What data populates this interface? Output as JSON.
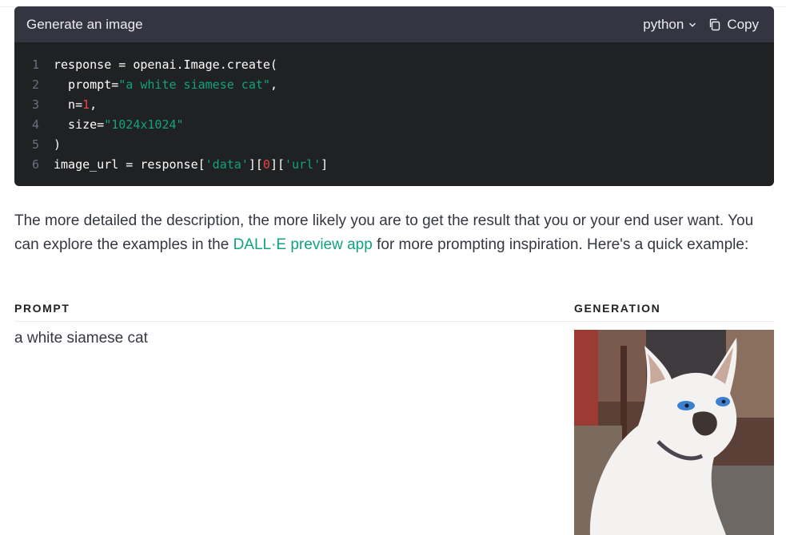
{
  "code_block": {
    "title": "Generate an image",
    "language": "python",
    "copy_label": "Copy",
    "lines": [
      {
        "n": "1",
        "parts": [
          {
            "t": "response = openai.Image.create(",
            "k": "plain"
          }
        ]
      },
      {
        "n": "2",
        "parts": [
          {
            "t": "  prompt=",
            "k": "plain"
          },
          {
            "t": "\"a white siamese cat\"",
            "k": "str"
          },
          {
            "t": ",",
            "k": "plain"
          }
        ]
      },
      {
        "n": "3",
        "parts": [
          {
            "t": "  n=",
            "k": "plain"
          },
          {
            "t": "1",
            "k": "num"
          },
          {
            "t": ",",
            "k": "plain"
          }
        ]
      },
      {
        "n": "4",
        "parts": [
          {
            "t": "  size=",
            "k": "plain"
          },
          {
            "t": "\"1024x1024\"",
            "k": "str"
          }
        ]
      },
      {
        "n": "5",
        "parts": [
          {
            "t": ")",
            "k": "plain"
          }
        ]
      },
      {
        "n": "6",
        "parts": [
          {
            "t": "image_url = response[",
            "k": "plain"
          },
          {
            "t": "'data'",
            "k": "str"
          },
          {
            "t": "][",
            "k": "plain"
          },
          {
            "t": "0",
            "k": "num"
          },
          {
            "t": "][",
            "k": "plain"
          },
          {
            "t": "'url'",
            "k": "str"
          },
          {
            "t": "]",
            "k": "plain"
          }
        ]
      }
    ]
  },
  "description": {
    "before_link": "The more detailed the description, the more likely you are to get the result that you or your end user want. You can explore the examples in the ",
    "link_text": "DALL·E preview app",
    "after_link": " for more prompting inspiration. Here's a quick example:"
  },
  "example_table": {
    "prompt_header": "PROMPT",
    "generation_header": "GENERATION",
    "prompt_text": "a white siamese cat"
  },
  "colors": {
    "code_bg": "#202123",
    "code_header_bg": "#343541",
    "accent_green": "#10a37f",
    "number_red": "#ef4146"
  },
  "icons": {
    "chevron": "chevron-down-icon",
    "copy": "copy-icon"
  }
}
